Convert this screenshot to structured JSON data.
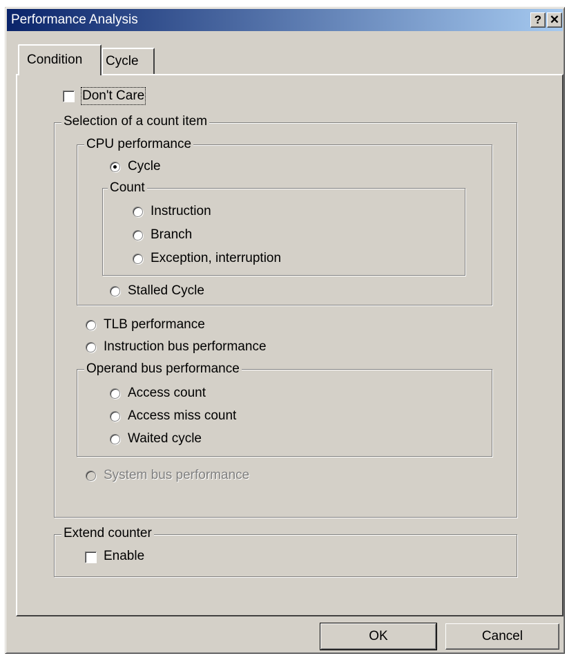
{
  "window": {
    "title": "Performance Analysis",
    "help_button": "?",
    "close_button": "✕"
  },
  "tabs": [
    {
      "label": "Condition",
      "selected": true
    },
    {
      "label": "Cycle",
      "selected": false
    }
  ],
  "dont_care": {
    "label": "Don't Care",
    "checked": false
  },
  "selection_group": {
    "title": "Selection of a count item",
    "cpu_group": {
      "title": "CPU performance",
      "cycle": {
        "label": "Cycle",
        "selected": true
      },
      "count_group": {
        "title": "Count",
        "options": [
          {
            "label": "Instruction"
          },
          {
            "label": "Branch"
          },
          {
            "label": "Exception, interruption"
          }
        ]
      },
      "stalled": {
        "label": "Stalled Cycle"
      }
    },
    "tlb": {
      "label": "TLB performance"
    },
    "instruction_bus": {
      "label": "Instruction bus performance"
    },
    "operand_group": {
      "title": "Operand bus performance",
      "options": [
        {
          "label": "Access count"
        },
        {
          "label": "Access miss count"
        },
        {
          "label": "Waited cycle"
        }
      ]
    },
    "system_bus": {
      "label": "System bus performance",
      "disabled": true
    }
  },
  "extend_group": {
    "title": "Extend counter",
    "enable": {
      "label": "Enable",
      "checked": false
    }
  },
  "buttons": {
    "ok": "OK",
    "cancel": "Cancel"
  },
  "colors": {
    "titlebar_start": "#0a246a",
    "titlebar_end": "#a6caf0",
    "face": "#d4d0c8"
  }
}
